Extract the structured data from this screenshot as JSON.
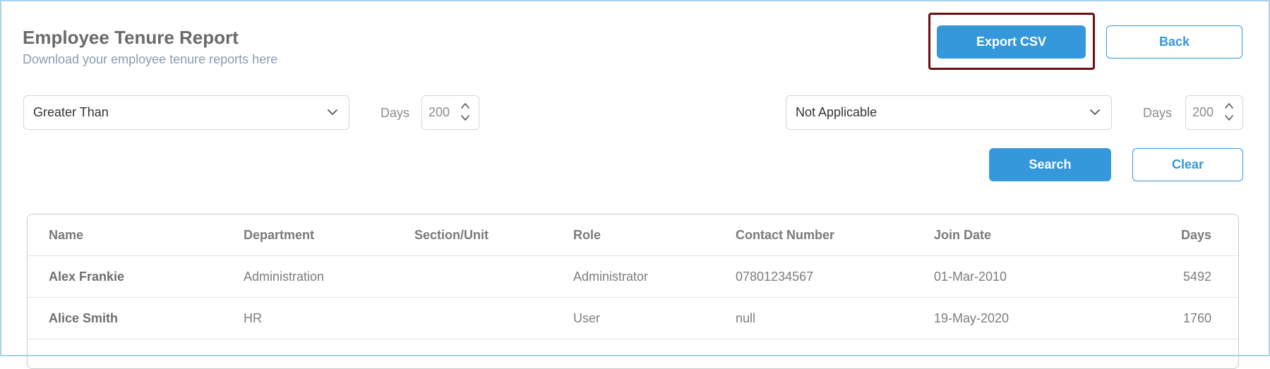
{
  "header": {
    "title": "Employee Tenure Report",
    "subtitle": "Download your employee tenure reports here",
    "export_label": "Export CSV",
    "back_label": "Back"
  },
  "filters": {
    "filter1": {
      "selected": "Greater Than",
      "days_label": "Days",
      "days_value": "200"
    },
    "filter2": {
      "selected": "Not Applicable",
      "days_label": "Days",
      "days_value": "200"
    },
    "search_label": "Search",
    "clear_label": "Clear"
  },
  "table": {
    "columns": [
      "Name",
      "Department",
      "Section/Unit",
      "Role",
      "Contact Number",
      "Join Date",
      "Days"
    ],
    "rows": [
      [
        "Alex Frankie",
        "Administration",
        "",
        "Administrator",
        "07801234567",
        "01-Mar-2010",
        "5492"
      ],
      [
        "Alice Smith",
        "HR",
        "",
        "User",
        "null",
        "19-May-2020",
        "1760"
      ]
    ]
  },
  "colors": {
    "accent": "#3498db",
    "highlight_border": "#6b0f12",
    "frame_border": "#a9d3ea"
  },
  "icons": {
    "dropdown": "chevron-down-icon",
    "stepper": "up-down-arrows-icon"
  }
}
